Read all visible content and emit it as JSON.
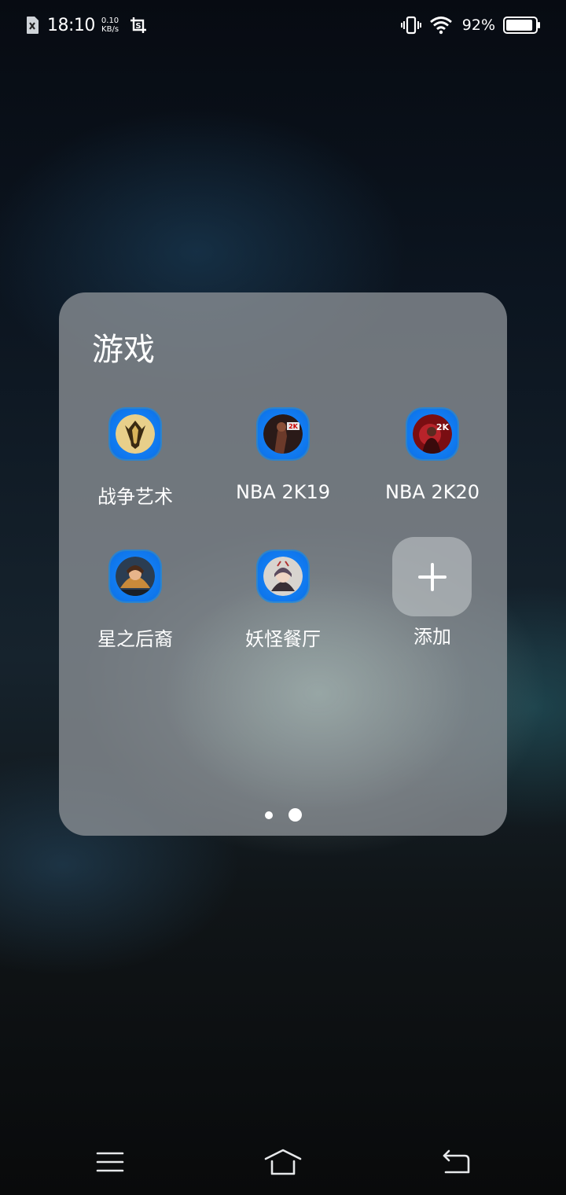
{
  "status_bar": {
    "time": "18:10",
    "net_speed_value": "0.10",
    "net_speed_unit": "KB/s",
    "battery_percent": "92%",
    "battery_level": 0.92,
    "icons": [
      "sim-icon",
      "screenshot-icon",
      "vibrate-icon",
      "wifi-icon",
      "battery-icon"
    ]
  },
  "folder": {
    "title": "游戏",
    "apps": [
      {
        "label": "战争艺术",
        "icon": "art-of-war-icon"
      },
      {
        "label": "NBA 2K19",
        "icon": "nba-2k19-icon"
      },
      {
        "label": "NBA 2K20",
        "icon": "nba-2k20-icon"
      },
      {
        "label": "星之后裔",
        "icon": "star-descendant-icon"
      },
      {
        "label": "妖怪餐厅",
        "icon": "yokai-restaurant-icon"
      }
    ],
    "add_label": "添加",
    "page_count": 2,
    "current_page": 2
  },
  "nav_bar": {
    "icons": [
      "menu-icon",
      "home-icon",
      "back-icon"
    ]
  },
  "colors": {
    "icon_ring": "#0a6fe6",
    "folder_bg": "#8c9196"
  }
}
